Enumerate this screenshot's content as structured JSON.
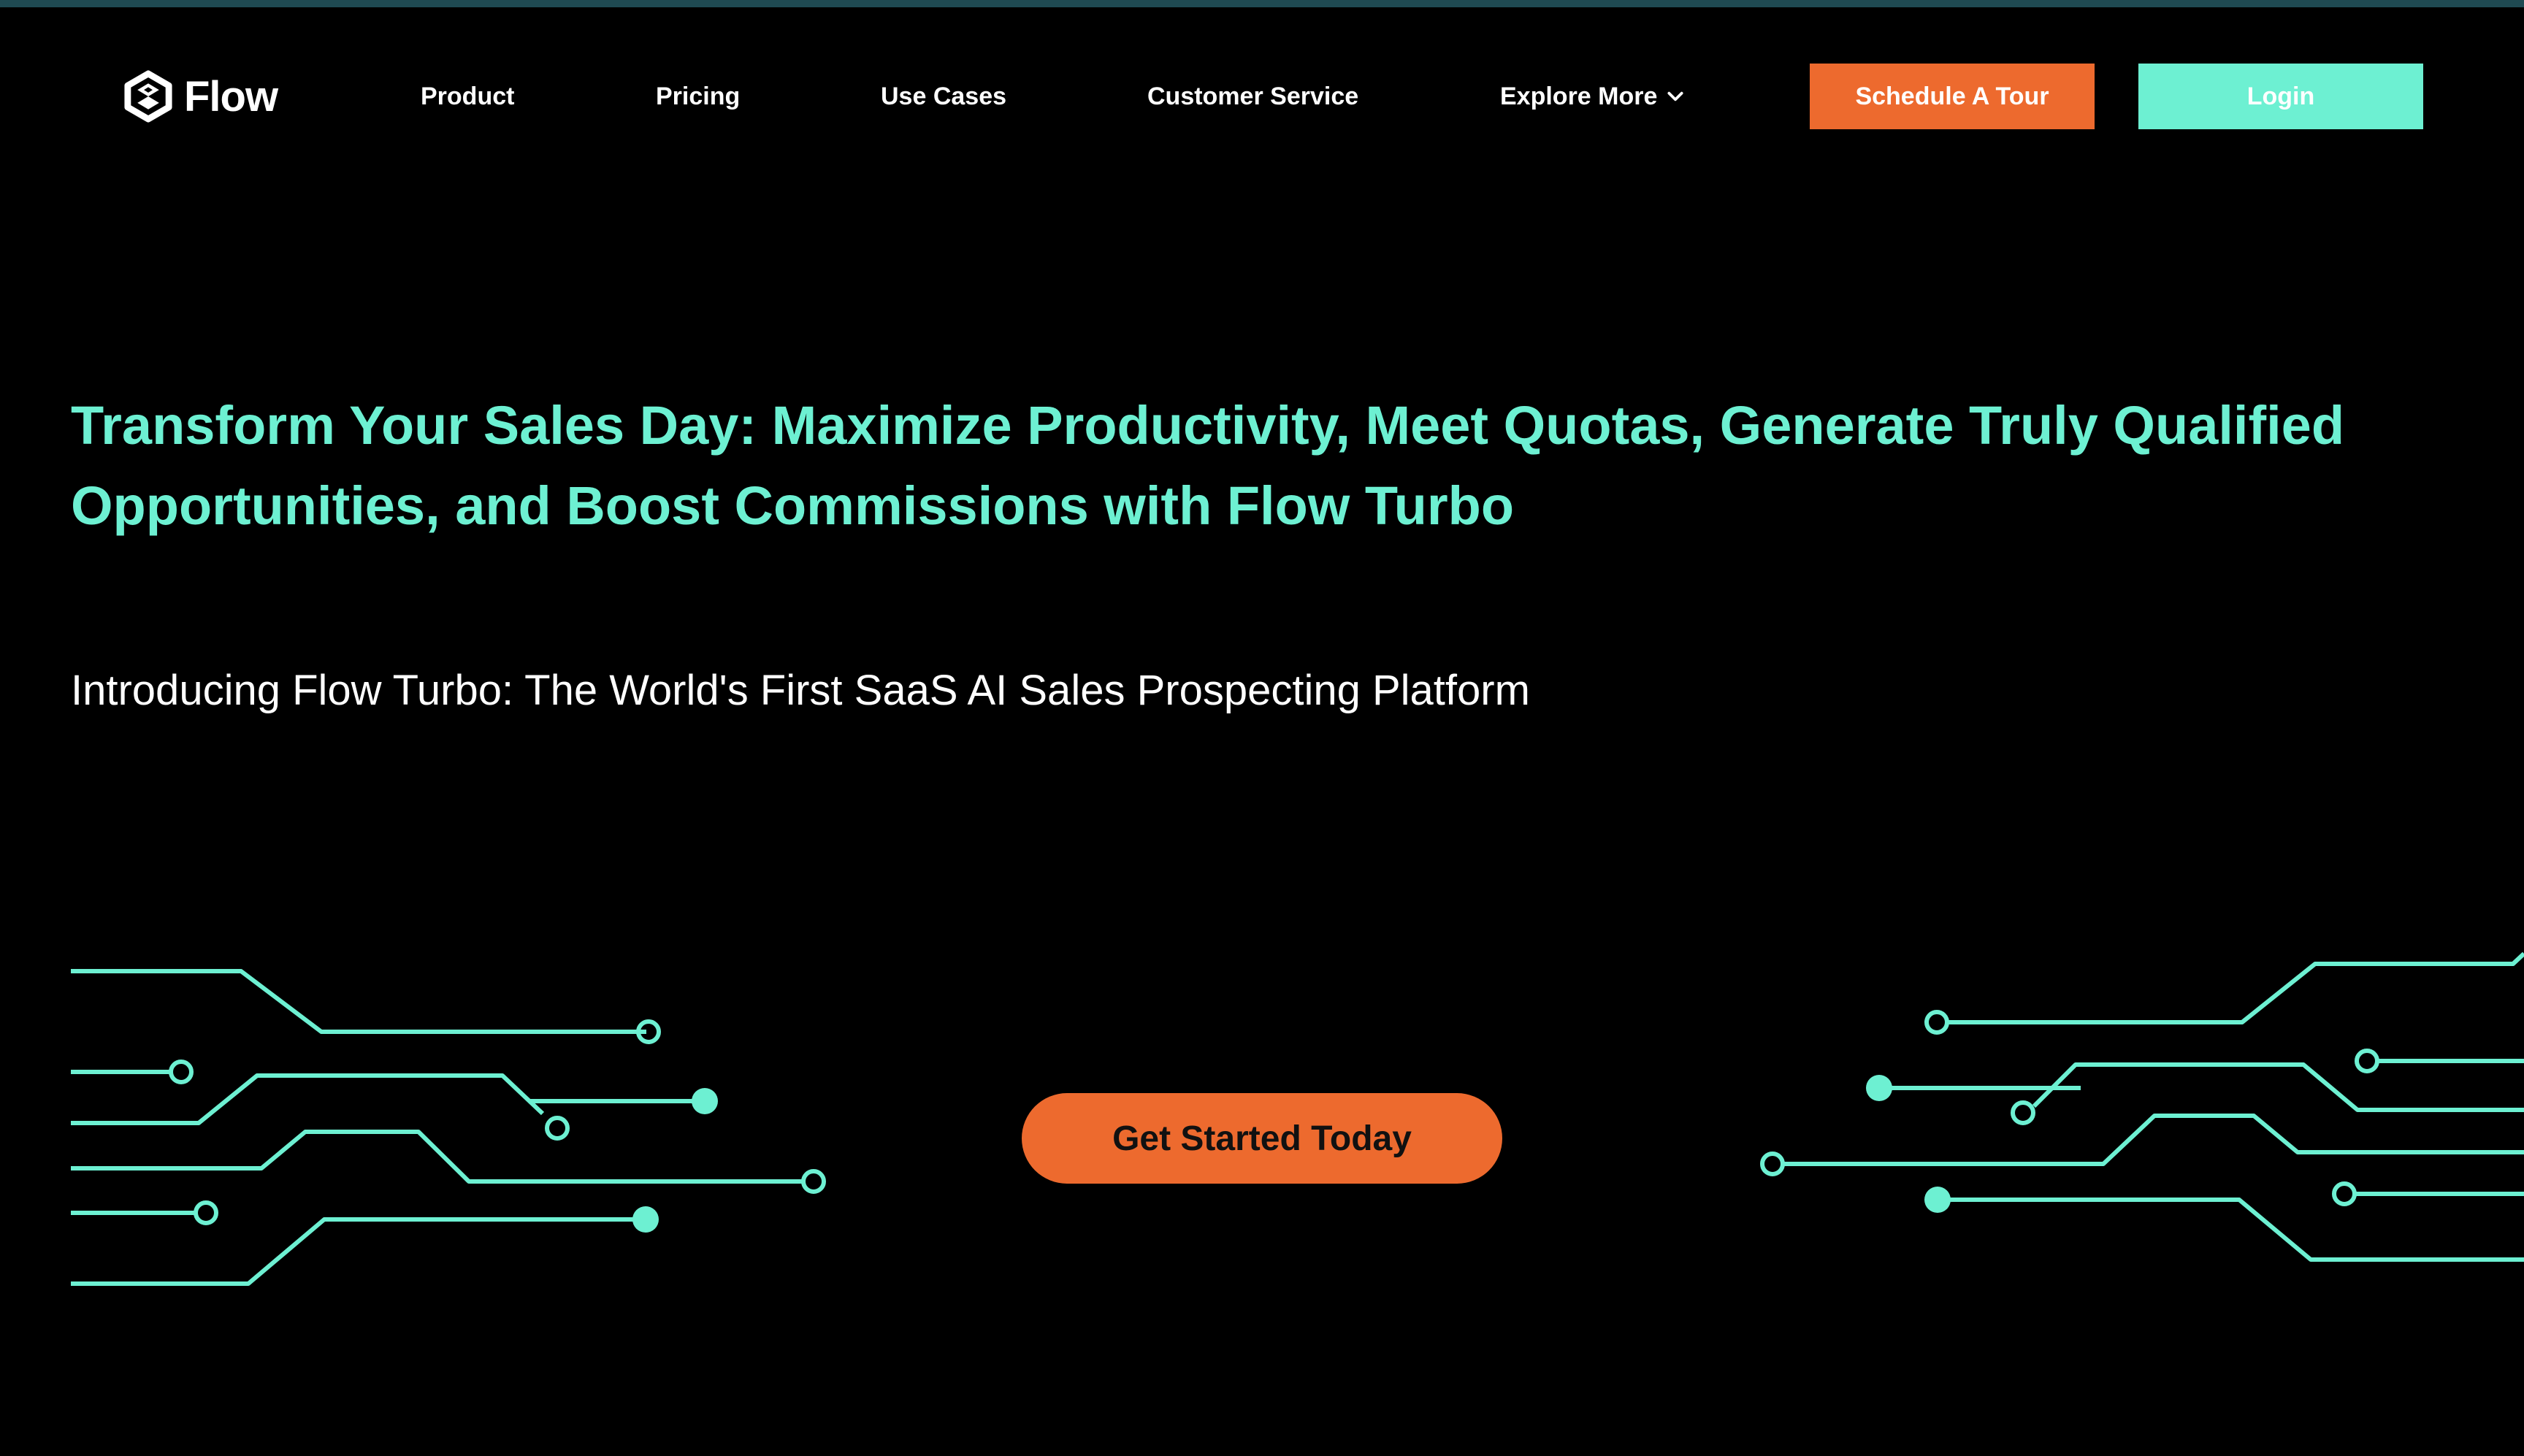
{
  "brand": {
    "name": "Flow",
    "logo_icon": "flow-logo-icon"
  },
  "nav": {
    "items": [
      {
        "label": "Product"
      },
      {
        "label": "Pricing"
      },
      {
        "label": "Use Cases"
      },
      {
        "label": "Customer Service"
      },
      {
        "label": "Explore More",
        "icon": "chevron-down-icon"
      }
    ],
    "schedule_label": "Schedule A Tour",
    "login_label": "Login"
  },
  "hero": {
    "headline": "Transform Your Sales Day: Maximize Productivity, Meet Quotas, Generate Truly Qualified Opportunities, and Boost Commissions with Flow Turbo",
    "subheadline": "Introducing Flow Turbo: The World's First SaaS AI Sales Prospecting Platform",
    "cta_label": "Get Started Today"
  },
  "colors": {
    "background": "#000000",
    "accent_teal": "#6df0d2",
    "accent_orange": "#ed6a2e",
    "text_light": "#ffffff"
  }
}
